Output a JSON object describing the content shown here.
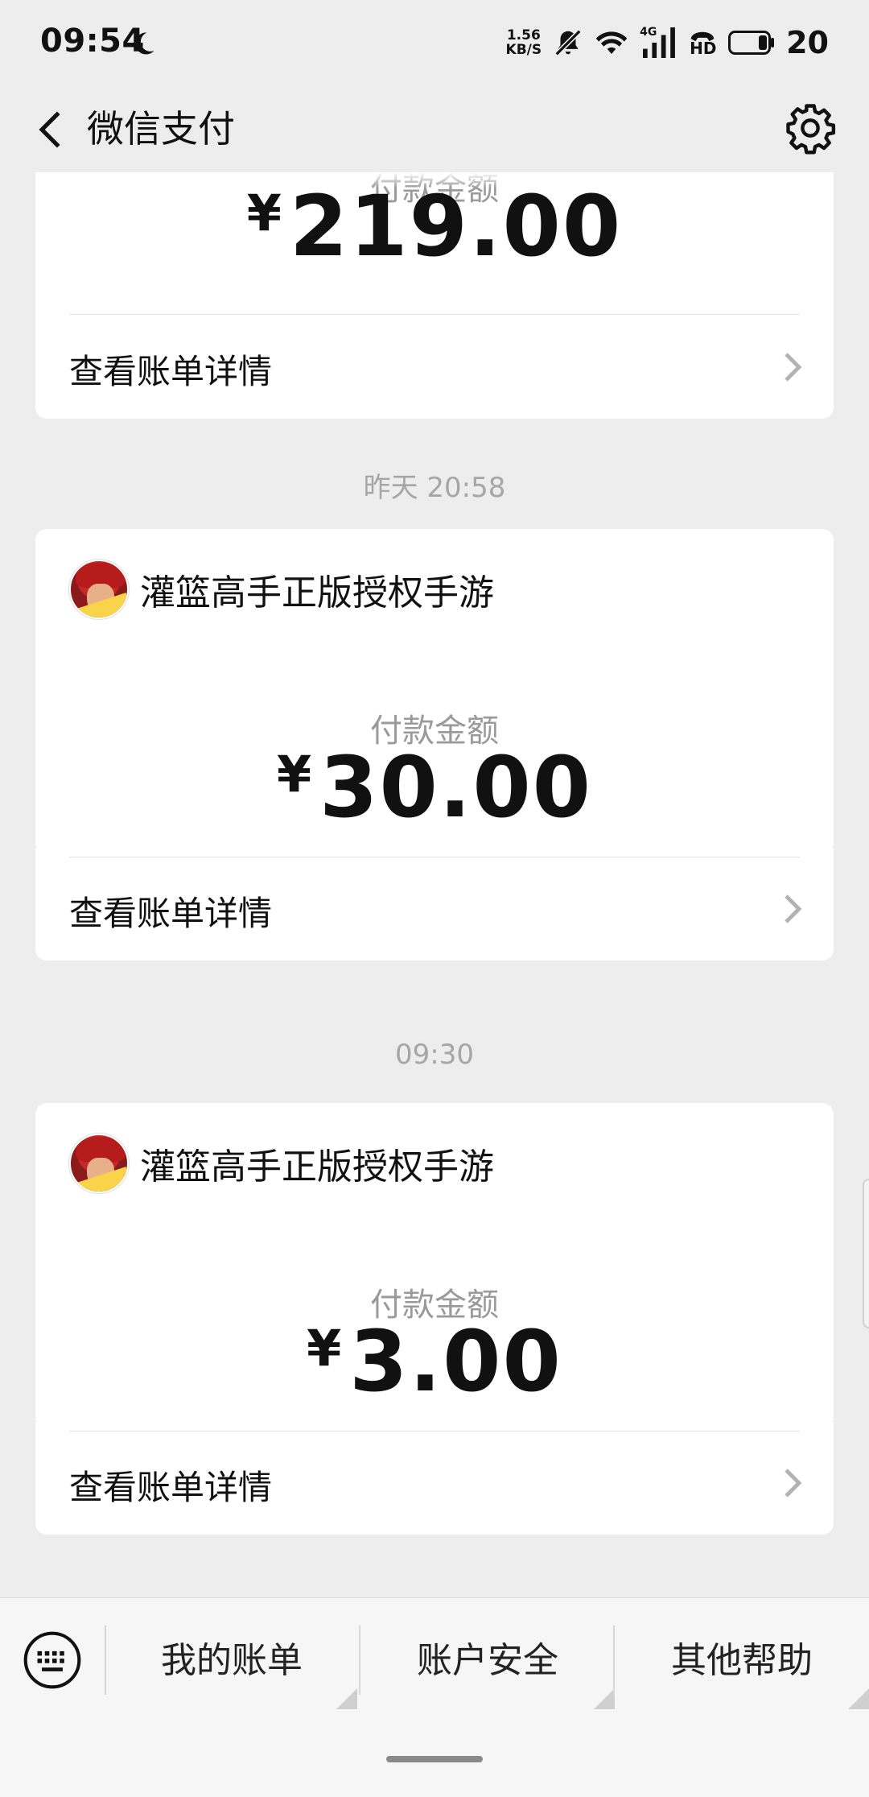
{
  "status_bar": {
    "time": "09:54",
    "net_speed_value": "1.56",
    "net_speed_unit": "KB/S",
    "network": "4G",
    "hd_label": "HD",
    "battery": "20"
  },
  "navbar": {
    "title": "微信支付"
  },
  "cards": [
    {
      "amount_label": "付款金额",
      "currency": "¥",
      "amount": "219.00",
      "detail_label": "查看账单详情"
    },
    {
      "timestamp": "昨天 20:58",
      "merchant": "灌篮高手正版授权手游",
      "amount_label": "付款金额",
      "currency": "¥",
      "amount": "30.00",
      "detail_label": "查看账单详情"
    },
    {
      "timestamp": "09:30",
      "merchant": "灌篮高手正版授权手游",
      "amount_label": "付款金额",
      "currency": "¥",
      "amount": "3.00",
      "detail_label": "查看账单详情"
    }
  ],
  "bottom_menu": {
    "items": [
      "我的账单",
      "账户安全",
      "其他帮助"
    ]
  },
  "colors": {
    "background": "#ededed",
    "card": "#ffffff",
    "muted_text": "#9a9a9a"
  }
}
